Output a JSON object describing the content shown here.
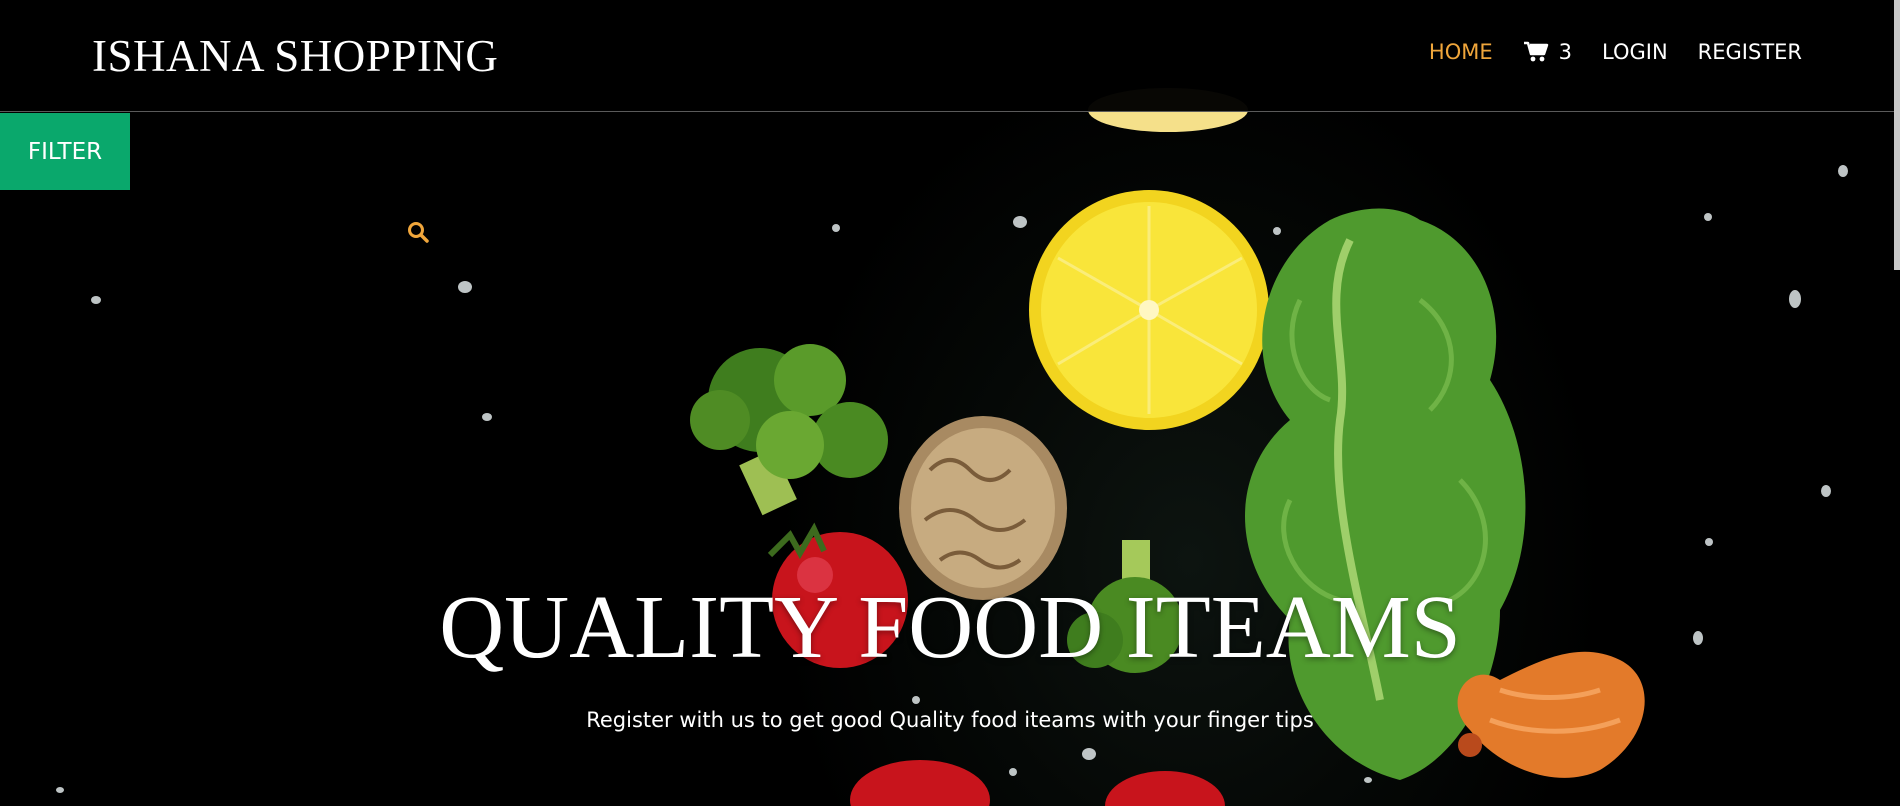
{
  "brand": "ISHANA SHOPPING",
  "nav": {
    "home": "HOME",
    "cart_count": "3",
    "login": "LOGIN",
    "register": "REGISTER"
  },
  "filter_label": "FILTER",
  "hero": {
    "headline": "QUALITY FOOD ITEAMS",
    "subtitle": "Register with us to get good Quality food iteams with your finger tips"
  },
  "icons": [
    "cart-icon",
    "search-icon"
  ],
  "colors": {
    "accent": "#f0a63b",
    "filter_bg": "#0aa86c",
    "background": "#000000",
    "text": "#ffffff"
  }
}
